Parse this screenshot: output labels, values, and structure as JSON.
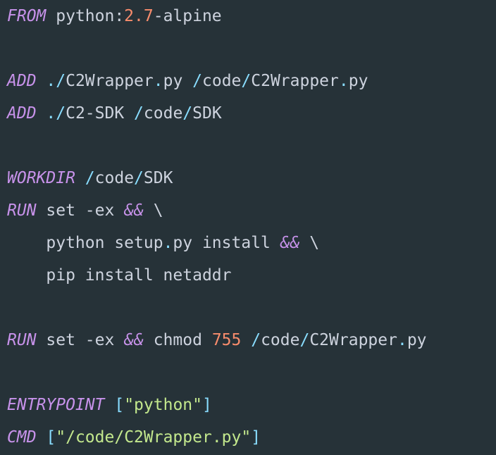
{
  "theme": {
    "background": "#263238",
    "text": "#cdd3de",
    "keyword": "#c792ea",
    "number": "#f78c6c",
    "punctuation": "#89ddff",
    "string": "#c3e88d"
  },
  "lines": [
    [
      {
        "text": "FROM",
        "type": "kw"
      },
      {
        "text": " python:",
        "type": "txt"
      },
      {
        "text": "2.7",
        "type": "num"
      },
      {
        "text": "-alpine",
        "type": "txt"
      }
    ],
    [],
    [
      {
        "text": "ADD",
        "type": "kw"
      },
      {
        "text": " ",
        "type": "txt"
      },
      {
        "text": "./",
        "type": "punc"
      },
      {
        "text": "C2Wrapper",
        "type": "txt"
      },
      {
        "text": ".",
        "type": "punc"
      },
      {
        "text": "py ",
        "type": "txt"
      },
      {
        "text": "/",
        "type": "punc"
      },
      {
        "text": "code",
        "type": "txt"
      },
      {
        "text": "/",
        "type": "punc"
      },
      {
        "text": "C2Wrapper",
        "type": "txt"
      },
      {
        "text": ".",
        "type": "punc"
      },
      {
        "text": "py",
        "type": "txt"
      }
    ],
    [
      {
        "text": "ADD",
        "type": "kw"
      },
      {
        "text": " ",
        "type": "txt"
      },
      {
        "text": "./",
        "type": "punc"
      },
      {
        "text": "C2-SDK ",
        "type": "txt"
      },
      {
        "text": "/",
        "type": "punc"
      },
      {
        "text": "code",
        "type": "txt"
      },
      {
        "text": "/",
        "type": "punc"
      },
      {
        "text": "SDK",
        "type": "txt"
      }
    ],
    [],
    [
      {
        "text": "WORKDIR",
        "type": "kw"
      },
      {
        "text": " ",
        "type": "txt"
      },
      {
        "text": "/",
        "type": "punc"
      },
      {
        "text": "code",
        "type": "txt"
      },
      {
        "text": "/",
        "type": "punc"
      },
      {
        "text": "SDK",
        "type": "txt"
      }
    ],
    [
      {
        "text": "RUN",
        "type": "kw"
      },
      {
        "text": " set -ex ",
        "type": "txt"
      },
      {
        "text": "&&",
        "type": "kw"
      },
      {
        "text": " \\",
        "type": "txt"
      }
    ],
    [
      {
        "text": "    python setup",
        "type": "txt"
      },
      {
        "text": ".",
        "type": "punc"
      },
      {
        "text": "py install ",
        "type": "txt"
      },
      {
        "text": "&&",
        "type": "kw"
      },
      {
        "text": " \\",
        "type": "txt"
      }
    ],
    [
      {
        "text": "    pip install netaddr",
        "type": "txt"
      }
    ],
    [],
    [
      {
        "text": "RUN",
        "type": "kw"
      },
      {
        "text": " set -ex ",
        "type": "txt"
      },
      {
        "text": "&&",
        "type": "kw"
      },
      {
        "text": " chmod ",
        "type": "txt"
      },
      {
        "text": "755",
        "type": "num"
      },
      {
        "text": " ",
        "type": "txt"
      },
      {
        "text": "/",
        "type": "punc"
      },
      {
        "text": "code",
        "type": "txt"
      },
      {
        "text": "/",
        "type": "punc"
      },
      {
        "text": "C2Wrapper",
        "type": "txt"
      },
      {
        "text": ".",
        "type": "punc"
      },
      {
        "text": "py",
        "type": "txt"
      }
    ],
    [],
    [
      {
        "text": "ENTRYPOINT",
        "type": "kw"
      },
      {
        "text": " ",
        "type": "txt"
      },
      {
        "text": "[",
        "type": "punc"
      },
      {
        "text": "\"python\"",
        "type": "str"
      },
      {
        "text": "]",
        "type": "punc"
      }
    ],
    [
      {
        "text": "CMD",
        "type": "kw"
      },
      {
        "text": " ",
        "type": "txt"
      },
      {
        "text": "[",
        "type": "punc"
      },
      {
        "text": "\"/code/C2Wrapper.py\"",
        "type": "str"
      },
      {
        "text": "]",
        "type": "punc"
      }
    ]
  ]
}
